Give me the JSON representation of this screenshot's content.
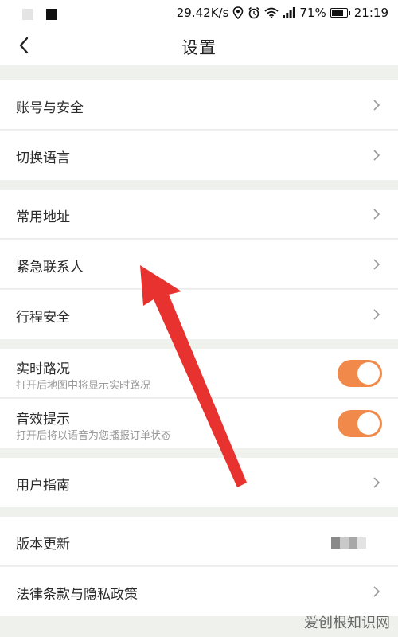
{
  "status_bar": {
    "speed": "29.42K/s",
    "battery": "71%",
    "time": "21:19"
  },
  "header": {
    "title": "设置"
  },
  "sections": {
    "account": [
      {
        "label": "账号与安全"
      },
      {
        "label": "切换语言"
      }
    ],
    "places": [
      {
        "label": "常用地址"
      },
      {
        "label": "紧急联系人"
      },
      {
        "label": "行程安全"
      }
    ],
    "toggles": [
      {
        "label": "实时路况",
        "subtitle": "打开后地图中将显示实时路况",
        "enabled": true
      },
      {
        "label": "音效提示",
        "subtitle": "打开后将以语音为您播报订单状态",
        "enabled": true
      }
    ],
    "guide": [
      {
        "label": "用户指南"
      }
    ],
    "about": [
      {
        "label": "版本更新"
      },
      {
        "label": "法律条款与隐私政策"
      }
    ]
  },
  "watermark": "爱创根知识网",
  "colors": {
    "accent": "#f0894a",
    "annotation_arrow": "#e8322f",
    "background": "#eef1ec"
  }
}
